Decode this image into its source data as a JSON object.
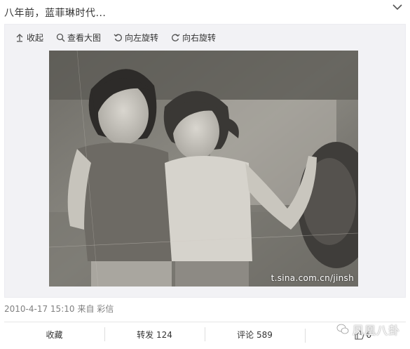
{
  "post": {
    "text": "八年前，蓝菲琳时代..."
  },
  "toolbar": {
    "collapse": "收起",
    "view_large": "查看大图",
    "rotate_left": "向左旋转",
    "rotate_right": "向右旋转"
  },
  "photo": {
    "watermark": "t.sina.com.cn/jinsh"
  },
  "meta": {
    "timestamp": "2010-4-17 15:10",
    "source": "来自 彩信"
  },
  "actions": {
    "favorite": "收藏",
    "repost": "转发 124",
    "comment": "评论 589",
    "like_count": "6"
  },
  "brand": {
    "name": "凤凰八卦"
  },
  "icons": [
    "chevron-down-icon",
    "collapse-arrow-icon",
    "magnifier-icon",
    "rotate-left-icon",
    "rotate-right-icon",
    "thumbs-up-icon",
    "wechat-bubble-icon"
  ]
}
